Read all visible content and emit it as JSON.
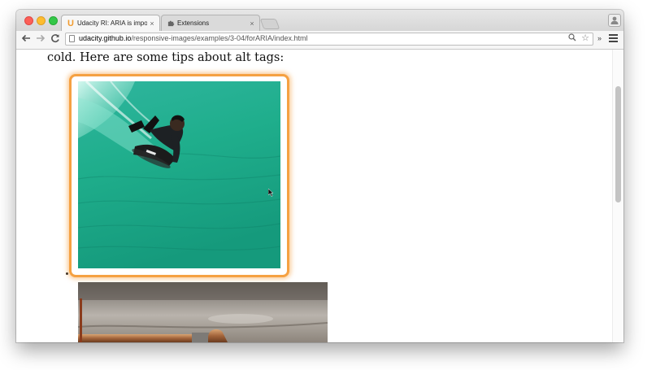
{
  "browser": {
    "tabs": [
      {
        "favicon": "U",
        "title": "Udacity RI: ARIA is importa",
        "close": "×",
        "active": true
      },
      {
        "favicon": "puzzle-icon",
        "title": "Extensions",
        "close": "×",
        "active": false
      }
    ],
    "address_bar": {
      "host": "udacity.github.io",
      "path": "/responsive-images/examples/3-04/forARIA/index.html"
    },
    "extensions_overflow": "»"
  },
  "page": {
    "intro_text": "cold. Here are some tips about alt tags:"
  },
  "colors": {
    "focus_ring": "#f5a142",
    "accent_orange": "#f29b2e"
  }
}
